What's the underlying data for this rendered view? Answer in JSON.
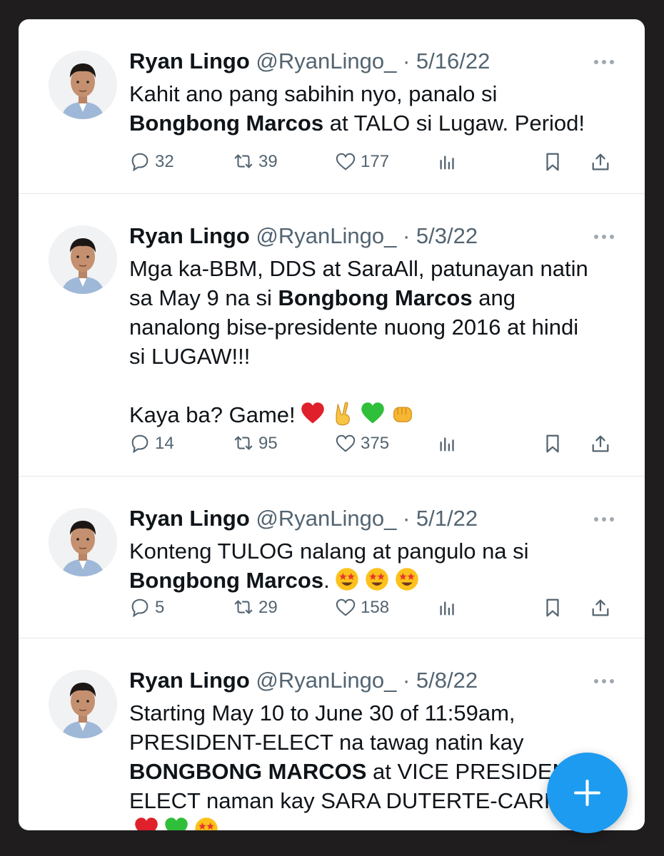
{
  "tweets": [
    {
      "name": "Ryan Lingo",
      "handle": "@RyanLingo_",
      "sep": " · ",
      "date": "5/16/22",
      "lines": [
        [
          "Kahit ano pang sabihin nyo, panalo si"
        ],
        [
          "@@Bongbong Marcos",
          " at TALO si Lugaw. Period!"
        ]
      ],
      "replies": "32",
      "retweets": "39",
      "likes": "177"
    },
    {
      "name": "Ryan Lingo",
      "handle": "@RyanLingo_",
      "sep": " · ",
      "date": "5/3/22",
      "lines": [
        [
          "Mga ka-BBM, DDS at SaraAll, patunayan natin"
        ],
        [
          "sa May 9 na si ",
          "@@Bongbong Marcos",
          " ang"
        ],
        [
          "nanalong bise-presidente nuong 2016 at hindi"
        ],
        [
          "si LUGAW!!!"
        ]
      ],
      "second_paragraph": "Kaya ba? Game!",
      "second_paragraph_emojis": [
        "red-heart",
        "victory-hand",
        "green-heart",
        "fist"
      ],
      "replies": "14",
      "retweets": "95",
      "likes": "375"
    },
    {
      "name": "Ryan Lingo",
      "handle": "@RyanLingo_",
      "sep": " · ",
      "date": "5/1/22",
      "lines": [
        [
          "Konteng TULOG nalang at pangulo na si"
        ],
        [
          "@@Bongbong Marcos",
          "."
        ]
      ],
      "line_emojis": [
        "star-struck",
        "star-struck",
        "star-struck"
      ],
      "replies": "5",
      "retweets": "29",
      "likes": "158"
    },
    {
      "name": "Ryan Lingo",
      "handle": "@RyanLingo_",
      "sep": " · ",
      "date": "5/8/22",
      "lines": [
        [
          "Starting May 10 to June 30 of 11:59am,"
        ],
        [
          "PRESIDENT-ELECT na tawag natin kay"
        ],
        [
          "@@BONGBONG MARCOS",
          " at VICE PRESIDENT-"
        ],
        [
          "ELECT naman kay SARA DUTERTE-CARPIO."
        ]
      ],
      "trailing_emojis": [
        "red-heart",
        "green-heart",
        "star-struck"
      ],
      "replies": "",
      "retweets": "",
      "likes": ""
    }
  ],
  "icons": {
    "reply": "speech-bubble-icon",
    "retweet": "retweet-icon",
    "like": "heart-icon",
    "views": "analytics-icon",
    "bookmark": "bookmark-icon",
    "share": "share-icon",
    "compose": "plus-icon"
  },
  "colors": {
    "accent": "#1d9bf0",
    "text": "#0f1419",
    "secondary": "#536471"
  }
}
